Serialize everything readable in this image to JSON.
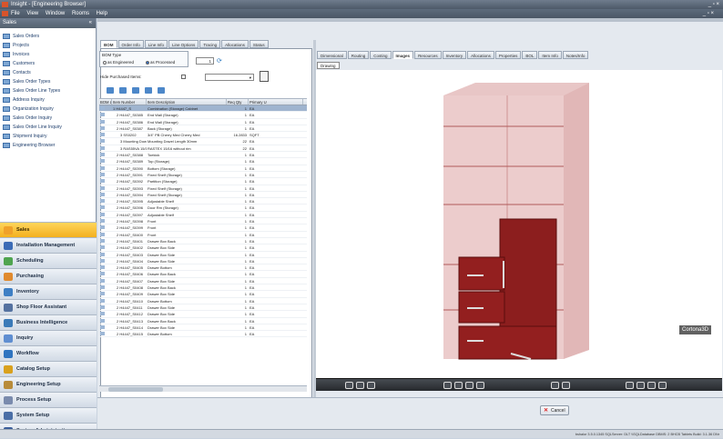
{
  "window": {
    "title": "Insight - [Engineering Browser]"
  },
  "menu": {
    "items": [
      "File",
      "View",
      "Window",
      "Rooms",
      "Help"
    ],
    "controls": "_ ▫ ×"
  },
  "sidebar": {
    "header": "Sales",
    "collapse": "«",
    "links": [
      "Sales Orders",
      "Projects",
      "Invoices",
      "Customers",
      "Contacts",
      "Sales Order Types",
      "Sales Order Line Types",
      "Address Inquiry",
      "Organization Inquiry",
      "Sales Order Inquiry",
      "Sales Order Line Inquiry",
      "Shipment Inquiry",
      "Engineering Browser"
    ],
    "modules": [
      "Sales",
      "Installation Management",
      "Scheduling",
      "Purchasing",
      "Inventory",
      "Shop Floor Assistant",
      "Business Intelligence",
      "Inquiry",
      "Workflow",
      "Catalog Setup",
      "Engineering Setup",
      "Process Setup",
      "System Setup",
      "System Administration"
    ],
    "active_module": "Sales"
  },
  "left_tabs": [
    "BOM",
    "Order Info",
    "Line Info",
    "Line Options",
    "Tracing",
    "Allocations",
    "Status"
  ],
  "right_tabs": [
    "Dimensional",
    "Routing",
    "Costing",
    "Images",
    "Resources",
    "Inventory",
    "Allocations",
    "Properties",
    "BOL",
    "Item Info",
    "Notes/Info"
  ],
  "bom_type": {
    "label": "BOM Type",
    "options": [
      "as Engineered",
      "as Processed"
    ],
    "selected": "as Processed"
  },
  "spinner": "1",
  "purchased": {
    "label": "Hide Purchased Items:"
  },
  "grid": {
    "headers": [
      "BOM Level",
      "Item Number",
      "Item Description",
      "Req Qty",
      "Primary U"
    ],
    "rows": [
      [
        "",
        "1",
        "H4447_S",
        "Combination (Storage) Cabinet",
        "1",
        "EA"
      ],
      [
        "",
        "2",
        "H4447_S0385",
        "End Wall (Storage)",
        "1",
        "EA"
      ],
      [
        "",
        "2",
        "H4447_S0386",
        "End Wall (Storage)",
        "1",
        "EA"
      ],
      [
        "",
        "2",
        "H4447_S0387",
        "Back (Storage)",
        "1",
        "EA"
      ],
      [
        "",
        "3",
        "SS0202",
        "3/4\" PB Cherry Med Cherry Med",
        "16.2833",
        "SQFT"
      ],
      [
        "",
        "3",
        "Mounting Dowel Length 30mm",
        "Mounting Dowel Length 30mm",
        "22",
        "EA"
      ],
      [
        "",
        "3",
        "RAS55VA 15/16 without rim",
        "RASTEX 15/16 without rim",
        "22",
        "EA"
      ],
      [
        "",
        "2",
        "H4447_S0388",
        "Toekick",
        "1",
        "EA"
      ],
      [
        "",
        "2",
        "H4447_S0389",
        "Top (Storage)",
        "1",
        "EA"
      ],
      [
        "",
        "2",
        "H4447_S0390",
        "Bottom (Storage)",
        "1",
        "EA"
      ],
      [
        "",
        "2",
        "H4447_S0391",
        "Fixed Shelf (Storage)",
        "1",
        "EA"
      ],
      [
        "",
        "2",
        "H4447_S0392",
        "Partition (Storage)",
        "1",
        "EA"
      ],
      [
        "",
        "2",
        "H4447_S0393",
        "Fixed Shelf (Storage)",
        "1",
        "EA"
      ],
      [
        "",
        "2",
        "H4447_S0394",
        "Fixed Shelf (Storage)",
        "1",
        "EA"
      ],
      [
        "",
        "2",
        "H4447_S0395",
        "Adjustable Shelf",
        "1",
        "EA"
      ],
      [
        "",
        "2",
        "H4447_S0396",
        "Door Rm (Storage)",
        "1",
        "EA"
      ],
      [
        "",
        "2",
        "H4447_S0397",
        "Adjustable Shelf",
        "1",
        "EA"
      ],
      [
        "",
        "2",
        "H4447_S0398",
        "Front",
        "1",
        "EA"
      ],
      [
        "",
        "2",
        "H4447_S0399",
        "Front",
        "1",
        "EA"
      ],
      [
        "",
        "2",
        "H4447_S0400",
        "Front",
        "1",
        "EA"
      ],
      [
        "",
        "2",
        "H4447_S0401",
        "Drawer Box Back",
        "1",
        "EA"
      ],
      [
        "",
        "2",
        "H4447_S0402",
        "Drawer Box Side",
        "1",
        "EA"
      ],
      [
        "",
        "2",
        "H4447_S0403",
        "Drawer Box Side",
        "1",
        "EA"
      ],
      [
        "",
        "2",
        "H4447_S0404",
        "Drawer Box Side",
        "1",
        "EA"
      ],
      [
        "",
        "2",
        "H4447_S0405",
        "Drawer Bottom",
        "1",
        "EA"
      ],
      [
        "",
        "2",
        "H4447_S0406",
        "Drawer Box Back",
        "1",
        "EA"
      ],
      [
        "",
        "2",
        "H4447_S0407",
        "Drawer Box Side",
        "1",
        "EA"
      ],
      [
        "",
        "2",
        "H4447_S0408",
        "Drawer Box Back",
        "1",
        "EA"
      ],
      [
        "",
        "2",
        "H4447_S0409",
        "Drawer Box Side",
        "1",
        "EA"
      ],
      [
        "",
        "2",
        "H4447_S0410",
        "Drawer Bottom",
        "1",
        "EA"
      ],
      [
        "",
        "2",
        "H4447_S0411",
        "Drawer Box Side",
        "1",
        "EA"
      ],
      [
        "",
        "2",
        "H4447_S0412",
        "Drawer Box Side",
        "1",
        "EA"
      ],
      [
        "",
        "2",
        "H4447_S0413",
        "Drawer Box Back",
        "1",
        "EA"
      ],
      [
        "",
        "2",
        "H4447_S0414",
        "Drawer Box Side",
        "1",
        "EA"
      ],
      [
        "",
        "2",
        "H4447_S0415",
        "Drawer Bottom",
        "1",
        "EA"
      ]
    ]
  },
  "viewer": {
    "tab": "Drawing",
    "brand": "Cortona3D"
  },
  "footer": {
    "cancel": "Cancel"
  },
  "status": "bshalor 3.5.0.1345  SQLServer: DLT  \\\\SQLDatabase  DBMS: 2  BHCB Tablets Build: 3.1.36 DNr"
}
